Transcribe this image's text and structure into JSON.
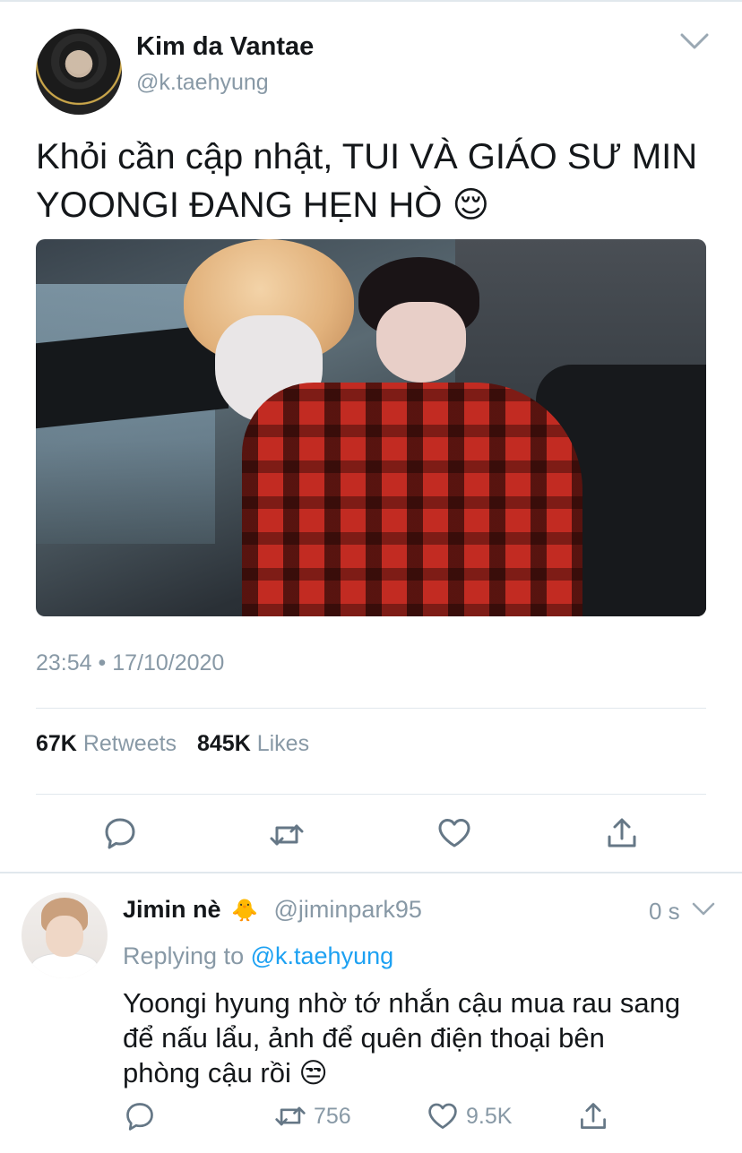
{
  "tweet": {
    "author": {
      "name": "Kim da Vantae",
      "handle": "@k.taehyung"
    },
    "text_line1": "Khỏi cần cập nhật, TUI VÀ GIÁO SƯ MIN",
    "text_line2": "YOONGI ĐANG HẸN HÒ 😌",
    "timestamp": "23:54 • 17/10/2020",
    "stats": {
      "retweets_count": "67K",
      "retweets_label": "Retweets",
      "likes_count": "845K",
      "likes_label": "Likes"
    }
  },
  "reply": {
    "author": {
      "name": "Jimin nè",
      "emoji": "🐥",
      "handle": "@jiminpark95"
    },
    "time": "0 s",
    "replying_prefix": "Replying to",
    "replying_to": "@k.taehyung",
    "text_line1": "Yoongi hyung nhờ tớ nhắn cậu mua rau sang",
    "text_line2": "để nấu lẩu, ảnh để quên điện thoại bên",
    "text_line3": "phòng cậu rồi 😒",
    "retweets": "756",
    "likes": "9.5K"
  },
  "colors": {
    "secondary_text": "#8899a6",
    "link": "#1da1f2",
    "divider": "#e1e8ed"
  },
  "icons": [
    "chevron-down-icon",
    "reply-icon",
    "retweet-icon",
    "like-icon",
    "share-icon"
  ]
}
